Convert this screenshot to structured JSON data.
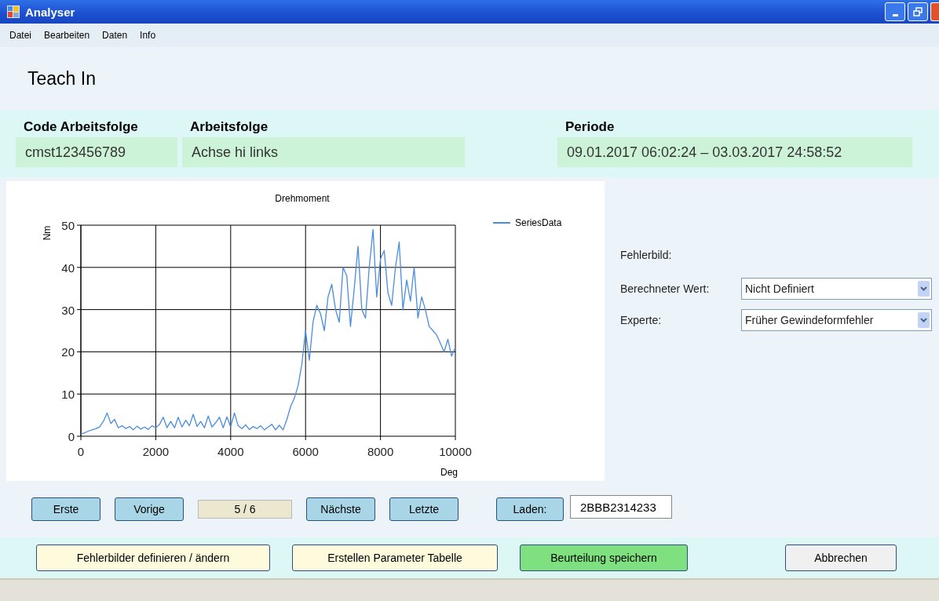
{
  "window": {
    "title": "Analyser"
  },
  "menu": [
    "Datei",
    "Bearbeiten",
    "Daten",
    "Info"
  ],
  "heading": "Teach In",
  "info": [
    {
      "label": "Code Arbeitsfolge",
      "value": "cmst123456789"
    },
    {
      "label": "Arbeitsfolge",
      "value": "Achse hi links"
    },
    {
      "label": "Periode",
      "value": "09.01.2017  06:02:24 – 03.03.2017  24:58:52"
    }
  ],
  "chart": {
    "chart_data": {
      "type": "line",
      "title": "Drehmoment",
      "xlabel": "Deg",
      "ylabel": "Nm",
      "xlim": [
        0,
        10000
      ],
      "ylim": [
        0,
        50
      ],
      "xticks": [
        0,
        2000,
        4000,
        6000,
        8000,
        10000
      ],
      "yticks": [
        0,
        10,
        20,
        30,
        40,
        50
      ],
      "grid": true,
      "x": [
        0,
        100,
        200,
        300,
        400,
        500,
        600,
        700,
        800,
        900,
        1000,
        1100,
        1200,
        1300,
        1400,
        1500,
        1600,
        1700,
        1800,
        1900,
        2000,
        2100,
        2200,
        2300,
        2400,
        2500,
        2600,
        2700,
        2800,
        2900,
        3000,
        3100,
        3200,
        3300,
        3400,
        3500,
        3600,
        3700,
        3800,
        3900,
        4000,
        4100,
        4200,
        4300,
        4400,
        4500,
        4600,
        4700,
        4800,
        4900,
        5000,
        5100,
        5200,
        5300,
        5400,
        5500,
        5600,
        5700,
        5800,
        5900,
        6000,
        6100,
        6200,
        6300,
        6400,
        6500,
        6600,
        6700,
        6800,
        6900,
        7000,
        7100,
        7200,
        7300,
        7400,
        7500,
        7600,
        7700,
        7800,
        7900,
        8000,
        8100,
        8200,
        8300,
        8400,
        8500,
        8600,
        8700,
        8800,
        8900,
        9000,
        9100,
        9200,
        9300,
        9400,
        9500,
        9600,
        9700,
        9800,
        9900,
        10000
      ],
      "series": [
        {
          "name": "SeriesData",
          "color": "#4a8de0",
          "values": [
            0.5,
            0.8,
            1.2,
            1.5,
            1.8,
            2.2,
            3.5,
            5.5,
            3,
            4,
            2,
            2.5,
            1.8,
            2.3,
            1.5,
            2.4,
            1.7,
            2.2,
            1.6,
            2.5,
            2,
            2.8,
            4.5,
            2,
            3.5,
            2,
            4.5,
            2.2,
            3.8,
            2.5,
            5.2,
            2.3,
            3.5,
            2,
            4.8,
            2.2,
            3.2,
            4.5,
            2,
            4.6,
            2.2,
            5.5,
            2.5,
            1.8,
            2.7,
            1.6,
            2.3,
            1.8,
            2.5,
            1.5,
            2.2,
            2.8,
            1.5,
            2.6,
            1.5,
            4,
            7,
            9,
            12,
            17,
            25,
            18,
            27,
            31,
            29,
            25,
            33,
            36,
            30,
            27,
            40,
            38,
            26,
            35,
            45,
            30,
            28,
            40,
            49,
            33,
            42,
            44,
            34,
            31,
            40,
            46,
            30,
            37,
            32,
            40,
            28,
            33,
            30,
            26,
            25,
            24,
            22,
            20,
            23,
            19,
            21
          ]
        }
      ]
    }
  },
  "fault": {
    "title": "Fehlerbild:",
    "fields": [
      {
        "label": "Berechneter Wert:",
        "value": "Nicht Definiert"
      },
      {
        "label": "Experte:",
        "value": "Früher Gewindeformfehler"
      }
    ]
  },
  "navigation": {
    "buttons": [
      "Erste",
      "Vorige"
    ],
    "counter": "5 / 6",
    "buttons_after": [
      "Nächste",
      "Letzte"
    ],
    "load_label": "Laden:",
    "load_value": "2BBB2314233"
  },
  "actions": [
    {
      "label": "Fehlerbilder definieren / ändern",
      "kind": "note"
    },
    {
      "label": "Erstellen Parameter Tabelle",
      "kind": "note"
    },
    {
      "label": "Beurteilung speichern",
      "kind": "save"
    },
    {
      "label": "Abbrechen",
      "kind": "plain"
    }
  ]
}
